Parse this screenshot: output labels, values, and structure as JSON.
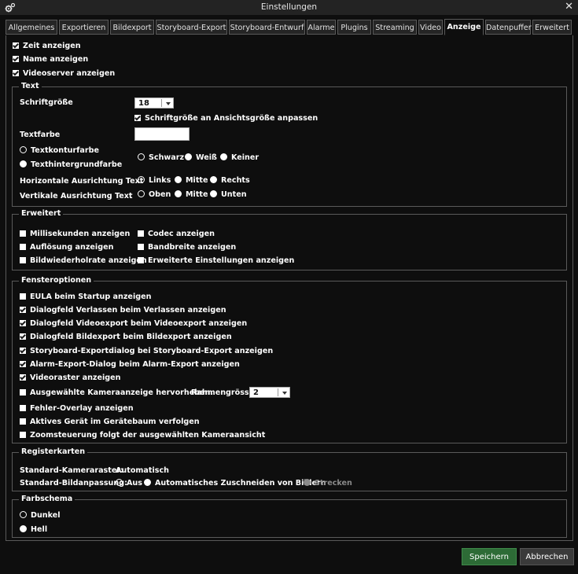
{
  "window": {
    "title": "Einstellungen",
    "close_glyph": "✕",
    "icon": "gear-icon"
  },
  "tabs": [
    {
      "label": "Allgemeines"
    },
    {
      "label": "Exportieren"
    },
    {
      "label": "Bildexport"
    },
    {
      "label": "Storyboard-Export"
    },
    {
      "label": "Storyboard-Entwurf"
    },
    {
      "label": "Alarme"
    },
    {
      "label": "Plugins"
    },
    {
      "label": "Streaming"
    },
    {
      "label": "Video"
    },
    {
      "label": "Anzeige",
      "active": true
    },
    {
      "label": "Datenpuffer"
    },
    {
      "label": "Erweitert"
    }
  ],
  "top_options": [
    {
      "label": "Zeit anzeigen",
      "checked": true
    },
    {
      "label": "Name anzeigen",
      "checked": true
    },
    {
      "label": "Videoserver anzeigen",
      "checked": true
    }
  ],
  "text_group": {
    "title": "Text",
    "font_size_label": "Schriftgröße",
    "font_size_value": "18",
    "fit_font_label": "Schriftgröße an Ansichtsgröße anpassen",
    "fit_font_checked": true,
    "text_color_label": "Textfarbe",
    "outline_label": "Textkonturfarbe",
    "background_label": "Texthintergrundfarbe",
    "bg_options": [
      "Schwarz",
      "Weiß",
      "Keiner"
    ],
    "h_align_label": "Horizontale Ausrichtung Text",
    "h_align_options": [
      "Links",
      "Mitte",
      "Rechts"
    ],
    "v_align_label": "Vertikale Ausrichtung Text",
    "v_align_options": [
      "Oben",
      "Mitte",
      "Unten"
    ]
  },
  "advanced_group": {
    "title": "Erweitert",
    "options": [
      {
        "label": "Millisekunden anzeigen",
        "checked": false
      },
      {
        "label": "Codec anzeigen",
        "checked": false
      },
      {
        "label": "Auflösung anzeigen",
        "checked": false
      },
      {
        "label": "Bandbreite anzeigen",
        "checked": false
      },
      {
        "label": "Bildwiederholrate anzeigen",
        "checked": false
      },
      {
        "label": "Erweiterte Einstellungen anzeigen",
        "checked": false
      }
    ]
  },
  "window_group": {
    "title": "Fensteroptionen",
    "options": [
      {
        "label": "EULA beim Startup anzeigen",
        "checked": false
      },
      {
        "label": "Dialogfeld Verlassen beim Verlassen anzeigen",
        "checked": true
      },
      {
        "label": "Dialogfeld Videoexport beim Videoexport anzeigen",
        "checked": true
      },
      {
        "label": "Dialogfeld Bildexport beim Bildexport anzeigen",
        "checked": true
      },
      {
        "label": "Storyboard-Exportdialog bei Storyboard-Export anzeigen",
        "checked": true
      },
      {
        "label": "Alarm-Export-Dialog beim Alarm-Export anzeigen",
        "checked": true
      },
      {
        "label": "Videoraster anzeigen",
        "checked": true
      },
      {
        "label": "Ausgewählte Kameraanzeige hervorheben.",
        "checked": false
      },
      {
        "label": "Fehler-Overlay anzeigen",
        "checked": false
      },
      {
        "label": "Aktives Gerät im Gerätebaum verfolgen",
        "checked": false
      },
      {
        "label": "Zoomsteuerung folgt der ausgewählten Kameraansicht",
        "checked": false
      }
    ],
    "frame_size_label": "Rahmengrösse",
    "frame_size_value": "2"
  },
  "tabs_group": {
    "title": "Registerkarten",
    "grid_label": "Standard-Kameraraster:",
    "grid_value": "Automatisch",
    "fit_label": "Standard-Bildanpassung:",
    "fit_options": [
      "Aus",
      "Automatisches Zuschneiden von Bildern",
      "Strecken"
    ]
  },
  "scheme_group": {
    "title": "Farbschema",
    "options": [
      {
        "label": "Dunkel",
        "selected": false
      },
      {
        "label": "Hell",
        "selected": true
      }
    ]
  },
  "buttons": {
    "save": "Speichern",
    "cancel": "Abbrechen"
  }
}
